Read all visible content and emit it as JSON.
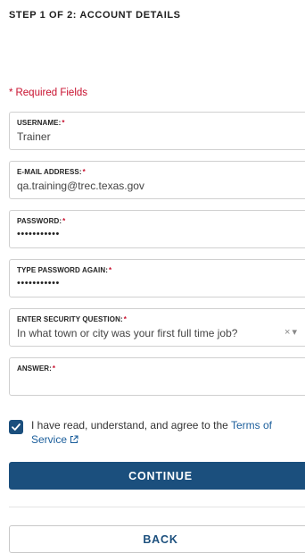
{
  "header": {
    "step_title": "STEP 1 OF 2: ACCOUNT DETAILS"
  },
  "required_note": {
    "star": "*",
    "text": "Required Fields"
  },
  "fields": {
    "username": {
      "label": "USERNAME:",
      "req": "*",
      "value": "Trainer"
    },
    "email": {
      "label": "E-MAIL ADDRESS:",
      "req": "*",
      "value": "qa.training@trec.texas.gov"
    },
    "password": {
      "label": "PASSWORD:",
      "req": "*",
      "value": "•••••••••••"
    },
    "password_again": {
      "label": "TYPE PASSWORD AGAIN:",
      "req": "*",
      "value": "•••••••••••"
    },
    "security_question": {
      "label": "ENTER SECURITY QUESTION:",
      "req": "*",
      "value": "In what town or city was your first full time job?"
    },
    "answer": {
      "label": "ANSWER:",
      "req": "*",
      "value": ""
    }
  },
  "agreement": {
    "checked": true,
    "text": "I have read, understand, and agree to the ",
    "link": "Terms of Service"
  },
  "buttons": {
    "continue": "CONTINUE",
    "back": "BACK"
  },
  "icons": {
    "clear": "×",
    "dropdown": "▾"
  },
  "colors": {
    "primary": "#1b4f7d",
    "required": "#c8102e",
    "link": "#1b5e9b"
  }
}
